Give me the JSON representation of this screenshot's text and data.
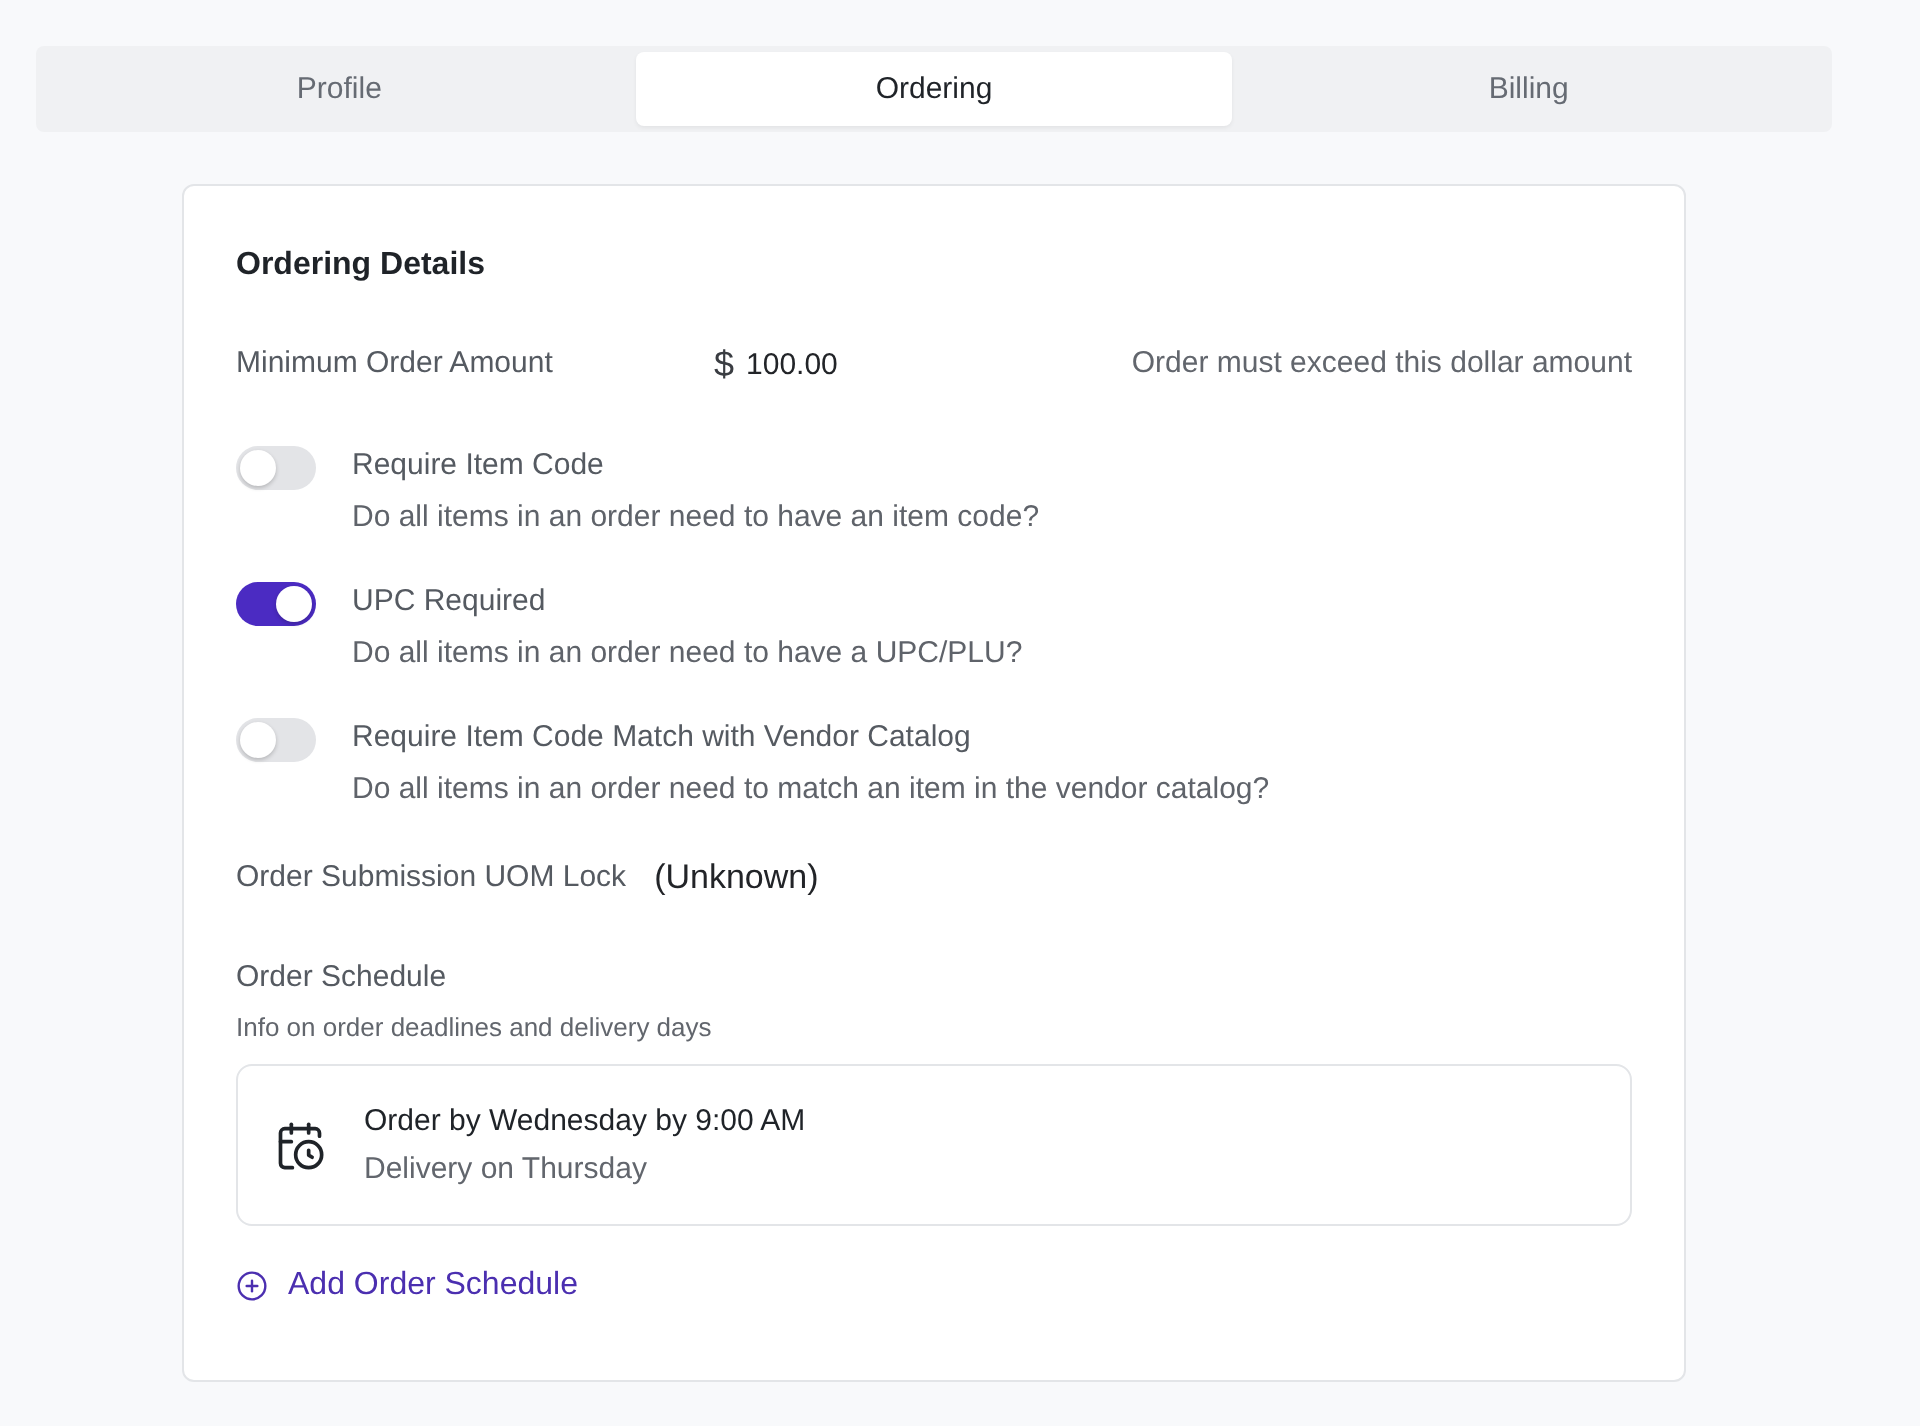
{
  "tabs": [
    {
      "label": "Profile",
      "selected": false
    },
    {
      "label": "Ordering",
      "selected": true
    },
    {
      "label": "Billing",
      "selected": false
    }
  ],
  "ordering_details": {
    "title": "Ordering Details",
    "minimum_order": {
      "label": "Minimum Order Amount",
      "currency": "$",
      "value": "100.00",
      "hint": "Order must exceed this dollar amount"
    },
    "toggles": [
      {
        "label": "Require Item Code",
        "description": "Do all items in an order need to have an item code?",
        "on": false
      },
      {
        "label": "UPC Required",
        "description": "Do all items in an order need to have a UPC/PLU?",
        "on": true
      },
      {
        "label": "Require Item Code Match with Vendor Catalog",
        "description": "Do all items in an order need to match an item in the vendor catalog?",
        "on": false
      }
    ],
    "uom_lock": {
      "label": "Order Submission UOM Lock",
      "value": "(Unknown)"
    },
    "order_schedule": {
      "title": "Order Schedule",
      "subtitle": "Info on order deadlines and delivery days",
      "entries": [
        {
          "title": "Order by Wednesday by 9:00 AM",
          "subtitle": "Delivery on Thursday"
        }
      ],
      "add_button": "Add Order Schedule"
    }
  }
}
